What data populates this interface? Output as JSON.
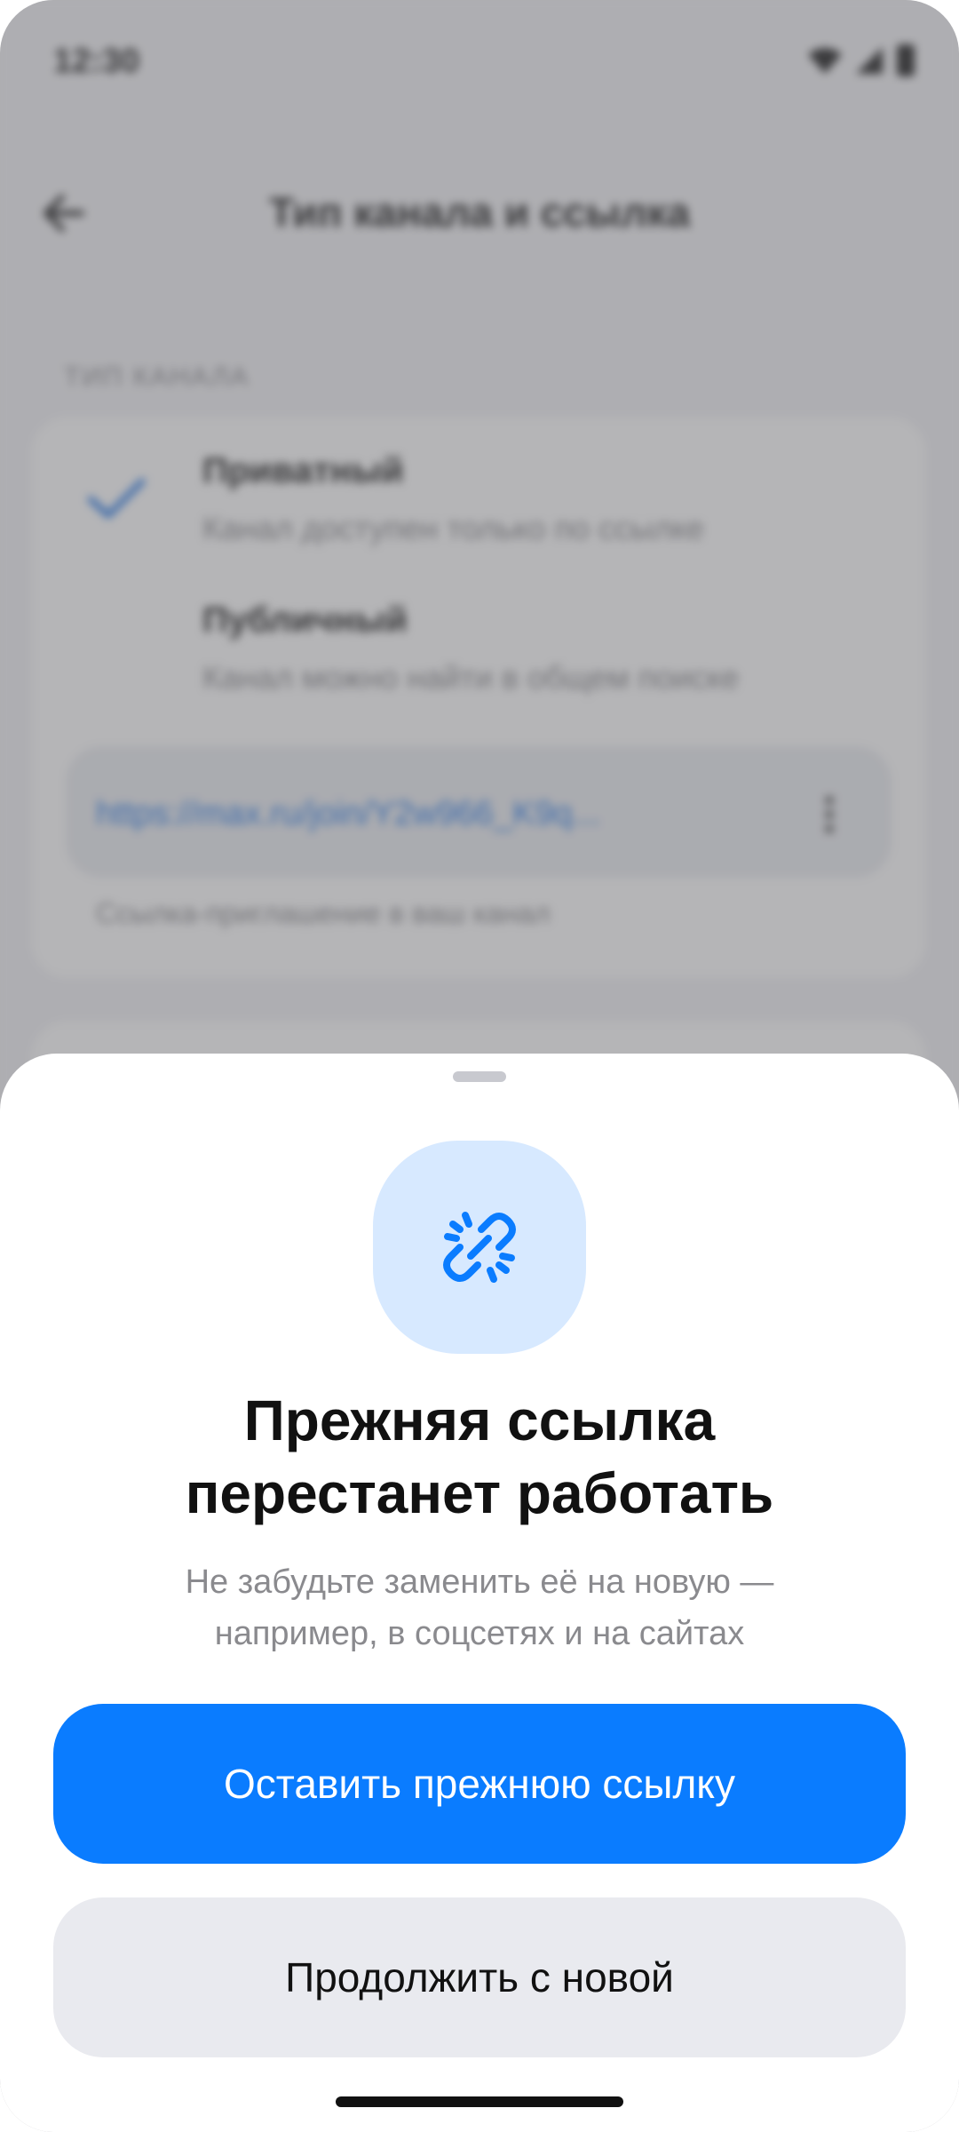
{
  "status_bar": {
    "time": "12:30",
    "icons": [
      "wifi-icon",
      "signal-icon",
      "battery-icon"
    ]
  },
  "background_screen": {
    "title": "Тип канала и ссылка",
    "section_label": "ТИП КАНАЛА",
    "options": [
      {
        "title": "Приватный",
        "subtitle": "Канал доступен только по ссылке",
        "selected": true
      },
      {
        "title": "Публичный",
        "subtitle": "Канал можно найти в общем поиске",
        "selected": false
      }
    ],
    "link": "https://max.ru/join/Y2w966_K9q...",
    "link_hint": "Ссылка-приглашение в ваш канал"
  },
  "sheet": {
    "icon": "broken-link-icon",
    "title_line1": "Прежняя ссылка",
    "title_line2": "перестанет работать",
    "subtitle_line1": "Не забудьте заменить её на новую —",
    "subtitle_line2": "например, в соцсетях и на сайтах",
    "primary_button": "Оставить прежнюю ссылку",
    "secondary_button": "Продолжить с новой"
  },
  "colors": {
    "accent": "#0a7cff",
    "icon_tile_bg": "#d7e9ff",
    "secondary_button_bg": "#e9eaef"
  }
}
